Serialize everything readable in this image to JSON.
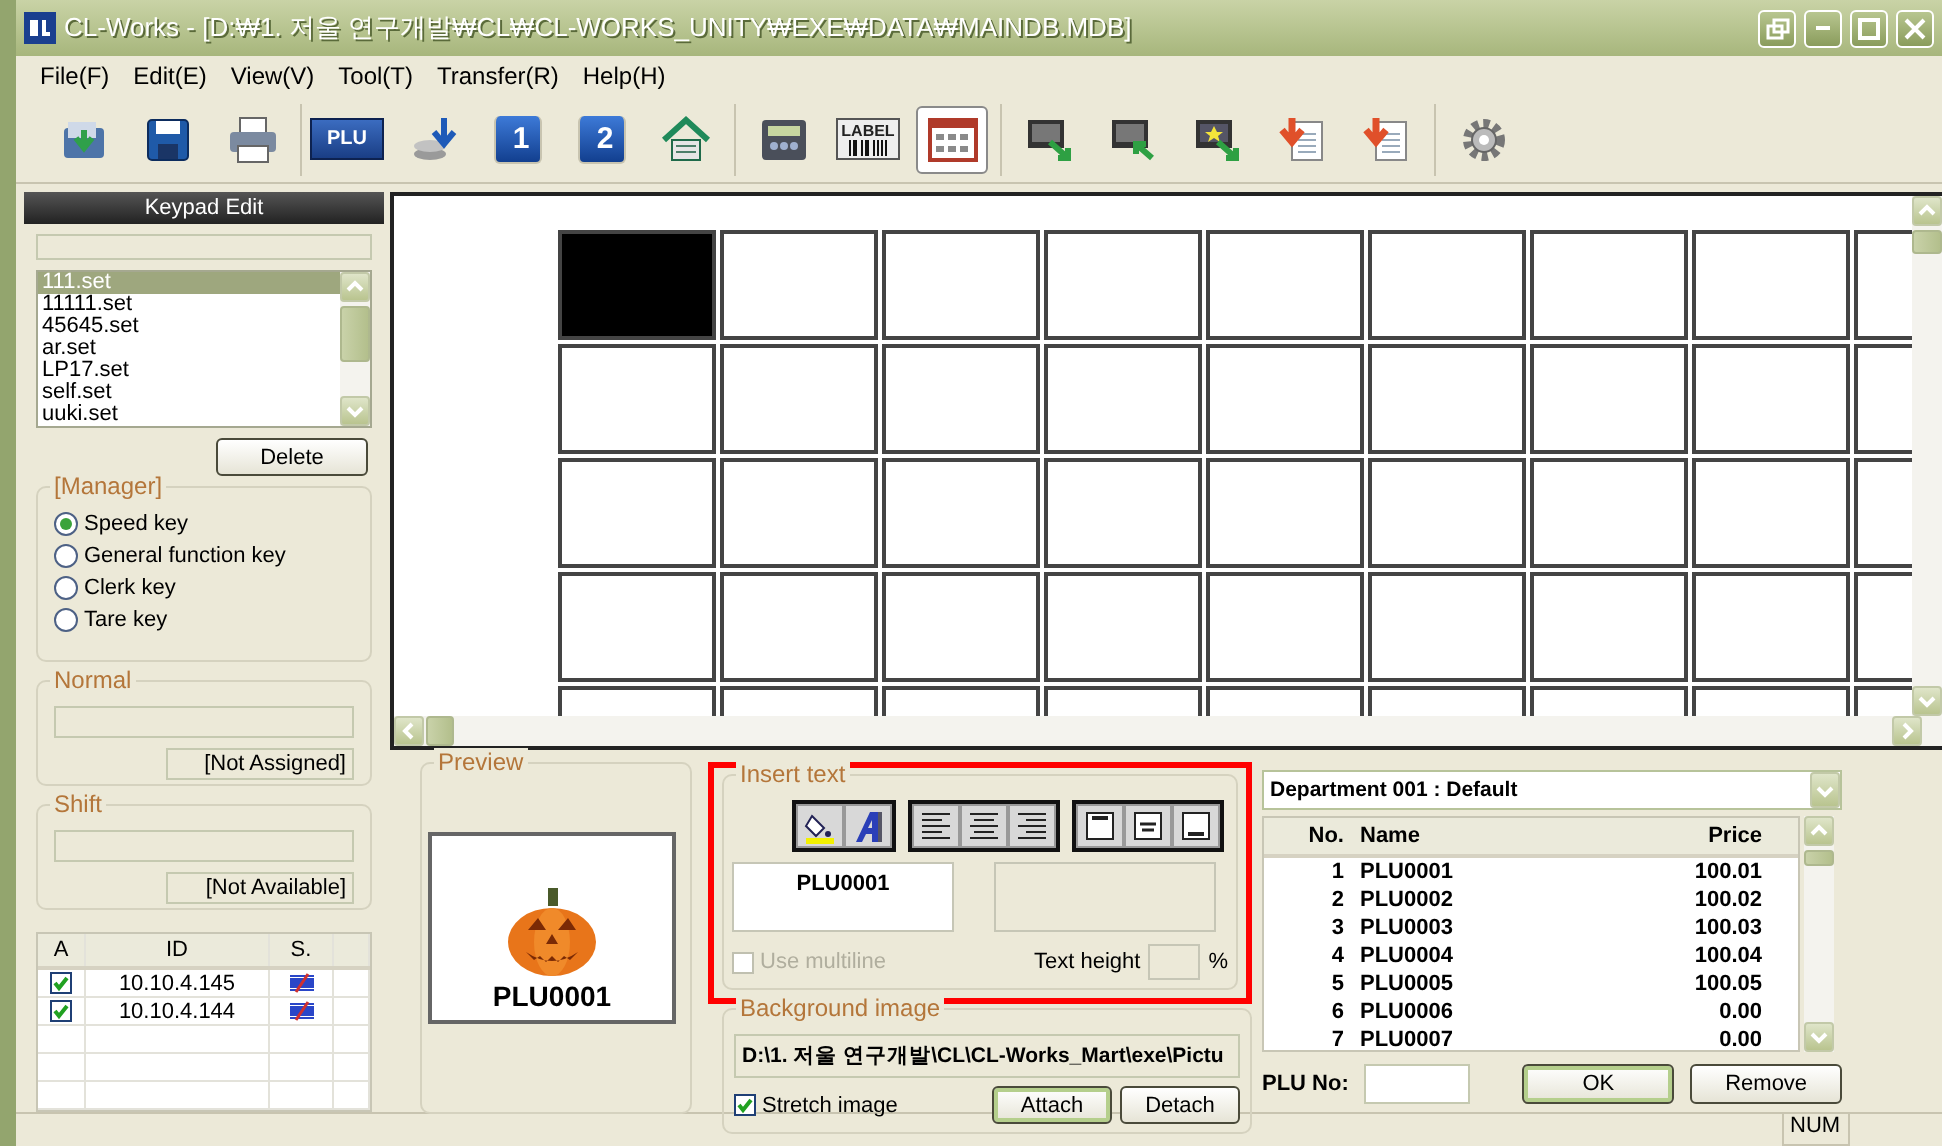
{
  "window": {
    "title": "CL-Works - [D:₩1. 저울 연구개발₩CL₩CL-WORKS_UNITY₩EXE₩DATA₩MAINDB.MDB]"
  },
  "menu": [
    "File(F)",
    "Edit(E)",
    "View(V)",
    "Tool(T)",
    "Transfer(R)",
    "Help(H)"
  ],
  "toolbar": [
    [
      {
        "kind": "open",
        "selected": false
      },
      {
        "kind": "save",
        "selected": false
      },
      {
        "kind": "print",
        "selected": false
      }
    ],
    [
      {
        "kind": "plu",
        "text": "PLU",
        "selected": false
      },
      {
        "kind": "download",
        "selected": false
      },
      {
        "kind": "number",
        "text": "1",
        "selected": false
      },
      {
        "kind": "number",
        "text": "2",
        "selected": false
      },
      {
        "kind": "home",
        "selected": false
      }
    ],
    [
      {
        "kind": "scale",
        "selected": false
      },
      {
        "kind": "label",
        "text": "LABEL",
        "selected": false
      },
      {
        "kind": "keypad",
        "selected": true
      }
    ],
    [
      {
        "kind": "send",
        "selected": false
      },
      {
        "kind": "receive",
        "selected": false
      },
      {
        "kind": "send_star",
        "selected": false
      },
      {
        "kind": "doc_down",
        "selected": false
      },
      {
        "kind": "doc_down",
        "selected": false
      }
    ],
    [
      {
        "kind": "settings",
        "selected": false
      }
    ]
  ],
  "keypad_edit": {
    "title": "Keypad Edit",
    "files": [
      {
        "label": "111.set",
        "selected": true
      },
      {
        "label": "11111.set",
        "selected": false
      },
      {
        "label": "45645.set",
        "selected": false
      },
      {
        "label": "ar.set",
        "selected": false
      },
      {
        "label": "LP17.set",
        "selected": false
      },
      {
        "label": "self.set",
        "selected": false
      },
      {
        "label": "uuki.set",
        "selected": false
      }
    ],
    "delete": "Delete",
    "manager": {
      "legend": "[Manager]",
      "options": [
        {
          "label": "Speed key",
          "selected": true
        },
        {
          "label": "General function key",
          "selected": false
        },
        {
          "label": "Clerk key",
          "selected": false
        },
        {
          "label": "Tare key",
          "selected": false
        }
      ]
    },
    "normal": {
      "legend": "Normal",
      "status": "[Not Assigned]"
    },
    "shift": {
      "legend": "Shift",
      "status": "[Not Available]"
    },
    "devices": {
      "columns": [
        "A",
        "ID",
        "S."
      ],
      "rows": [
        {
          "checked": true,
          "id": "10.10.4.145"
        },
        {
          "checked": true,
          "id": "10.10.4.144"
        }
      ]
    }
  },
  "keypad": {
    "rows": [
      [
        {
          "selected": true
        },
        {
          "selected": false
        },
        {
          "selected": false
        },
        {
          "selected": false
        },
        {
          "selected": false
        },
        {
          "selected": false
        },
        {
          "selected": false
        },
        {
          "selected": false
        },
        {
          "selected": false
        }
      ],
      [
        {
          "selected": false
        },
        {
          "selected": false
        },
        {
          "selected": false
        },
        {
          "selected": false
        },
        {
          "selected": false
        },
        {
          "selected": false
        },
        {
          "selected": false
        },
        {
          "selected": false
        },
        {
          "selected": false
        }
      ],
      [
        {
          "selected": false
        },
        {
          "selected": false
        },
        {
          "selected": false
        },
        {
          "selected": false
        },
        {
          "selected": false
        },
        {
          "selected": false
        },
        {
          "selected": false
        },
        {
          "selected": false
        },
        {
          "selected": false
        }
      ],
      [
        {
          "selected": false
        },
        {
          "selected": false
        },
        {
          "selected": false
        },
        {
          "selected": false
        },
        {
          "selected": false
        },
        {
          "selected": false
        },
        {
          "selected": false
        },
        {
          "selected": false
        },
        {
          "selected": false
        }
      ],
      [
        {
          "selected": false
        },
        {
          "selected": false
        },
        {
          "selected": false
        },
        {
          "selected": false
        },
        {
          "selected": false
        },
        {
          "selected": false
        },
        {
          "selected": false
        },
        {
          "selected": false
        },
        {
          "selected": false
        }
      ]
    ]
  },
  "preview": {
    "legend": "Preview",
    "caption": "PLU0001"
  },
  "insert_text": {
    "legend": "Insert text",
    "highlighted": true,
    "tools": [
      [
        {
          "kind": "fill_color"
        },
        {
          "kind": "font"
        }
      ],
      [
        {
          "kind": "align_left"
        },
        {
          "kind": "align_center"
        },
        {
          "kind": "align_right"
        }
      ],
      [
        {
          "kind": "valign_top"
        },
        {
          "kind": "valign_middle"
        },
        {
          "kind": "valign_bottom"
        }
      ]
    ],
    "text": "PLU0001",
    "multiline": {
      "label": "Use multiline",
      "checked": false,
      "disabled": true
    },
    "text_height_label": "Text height",
    "percent": "%"
  },
  "background_image": {
    "legend": "Background image",
    "path": "D:\\1. 저울 연구개발\\CL\\CL-Works_Mart\\exe\\Pictu",
    "stretch": {
      "label": "Stretch image",
      "checked": true
    },
    "attach": "Attach",
    "detach": "Detach"
  },
  "plu_list": {
    "department": "Department 001 : Default",
    "columns": [
      "No.",
      "Name",
      "Price"
    ],
    "rows": [
      {
        "no": "1",
        "name": "PLU0001",
        "price": "100.01"
      },
      {
        "no": "2",
        "name": "PLU0002",
        "price": "100.02"
      },
      {
        "no": "3",
        "name": "PLU0003",
        "price": "100.03"
      },
      {
        "no": "4",
        "name": "PLU0004",
        "price": "100.04"
      },
      {
        "no": "5",
        "name": "PLU0005",
        "price": "100.05"
      },
      {
        "no": "6",
        "name": "PLU0006",
        "price": "0.00"
      },
      {
        "no": "7",
        "name": "PLU0007",
        "price": "0.00"
      }
    ],
    "plu_no_label": "PLU No:",
    "ok": "OK",
    "remove": "Remove"
  },
  "status_bar": {
    "num": "NUM"
  }
}
